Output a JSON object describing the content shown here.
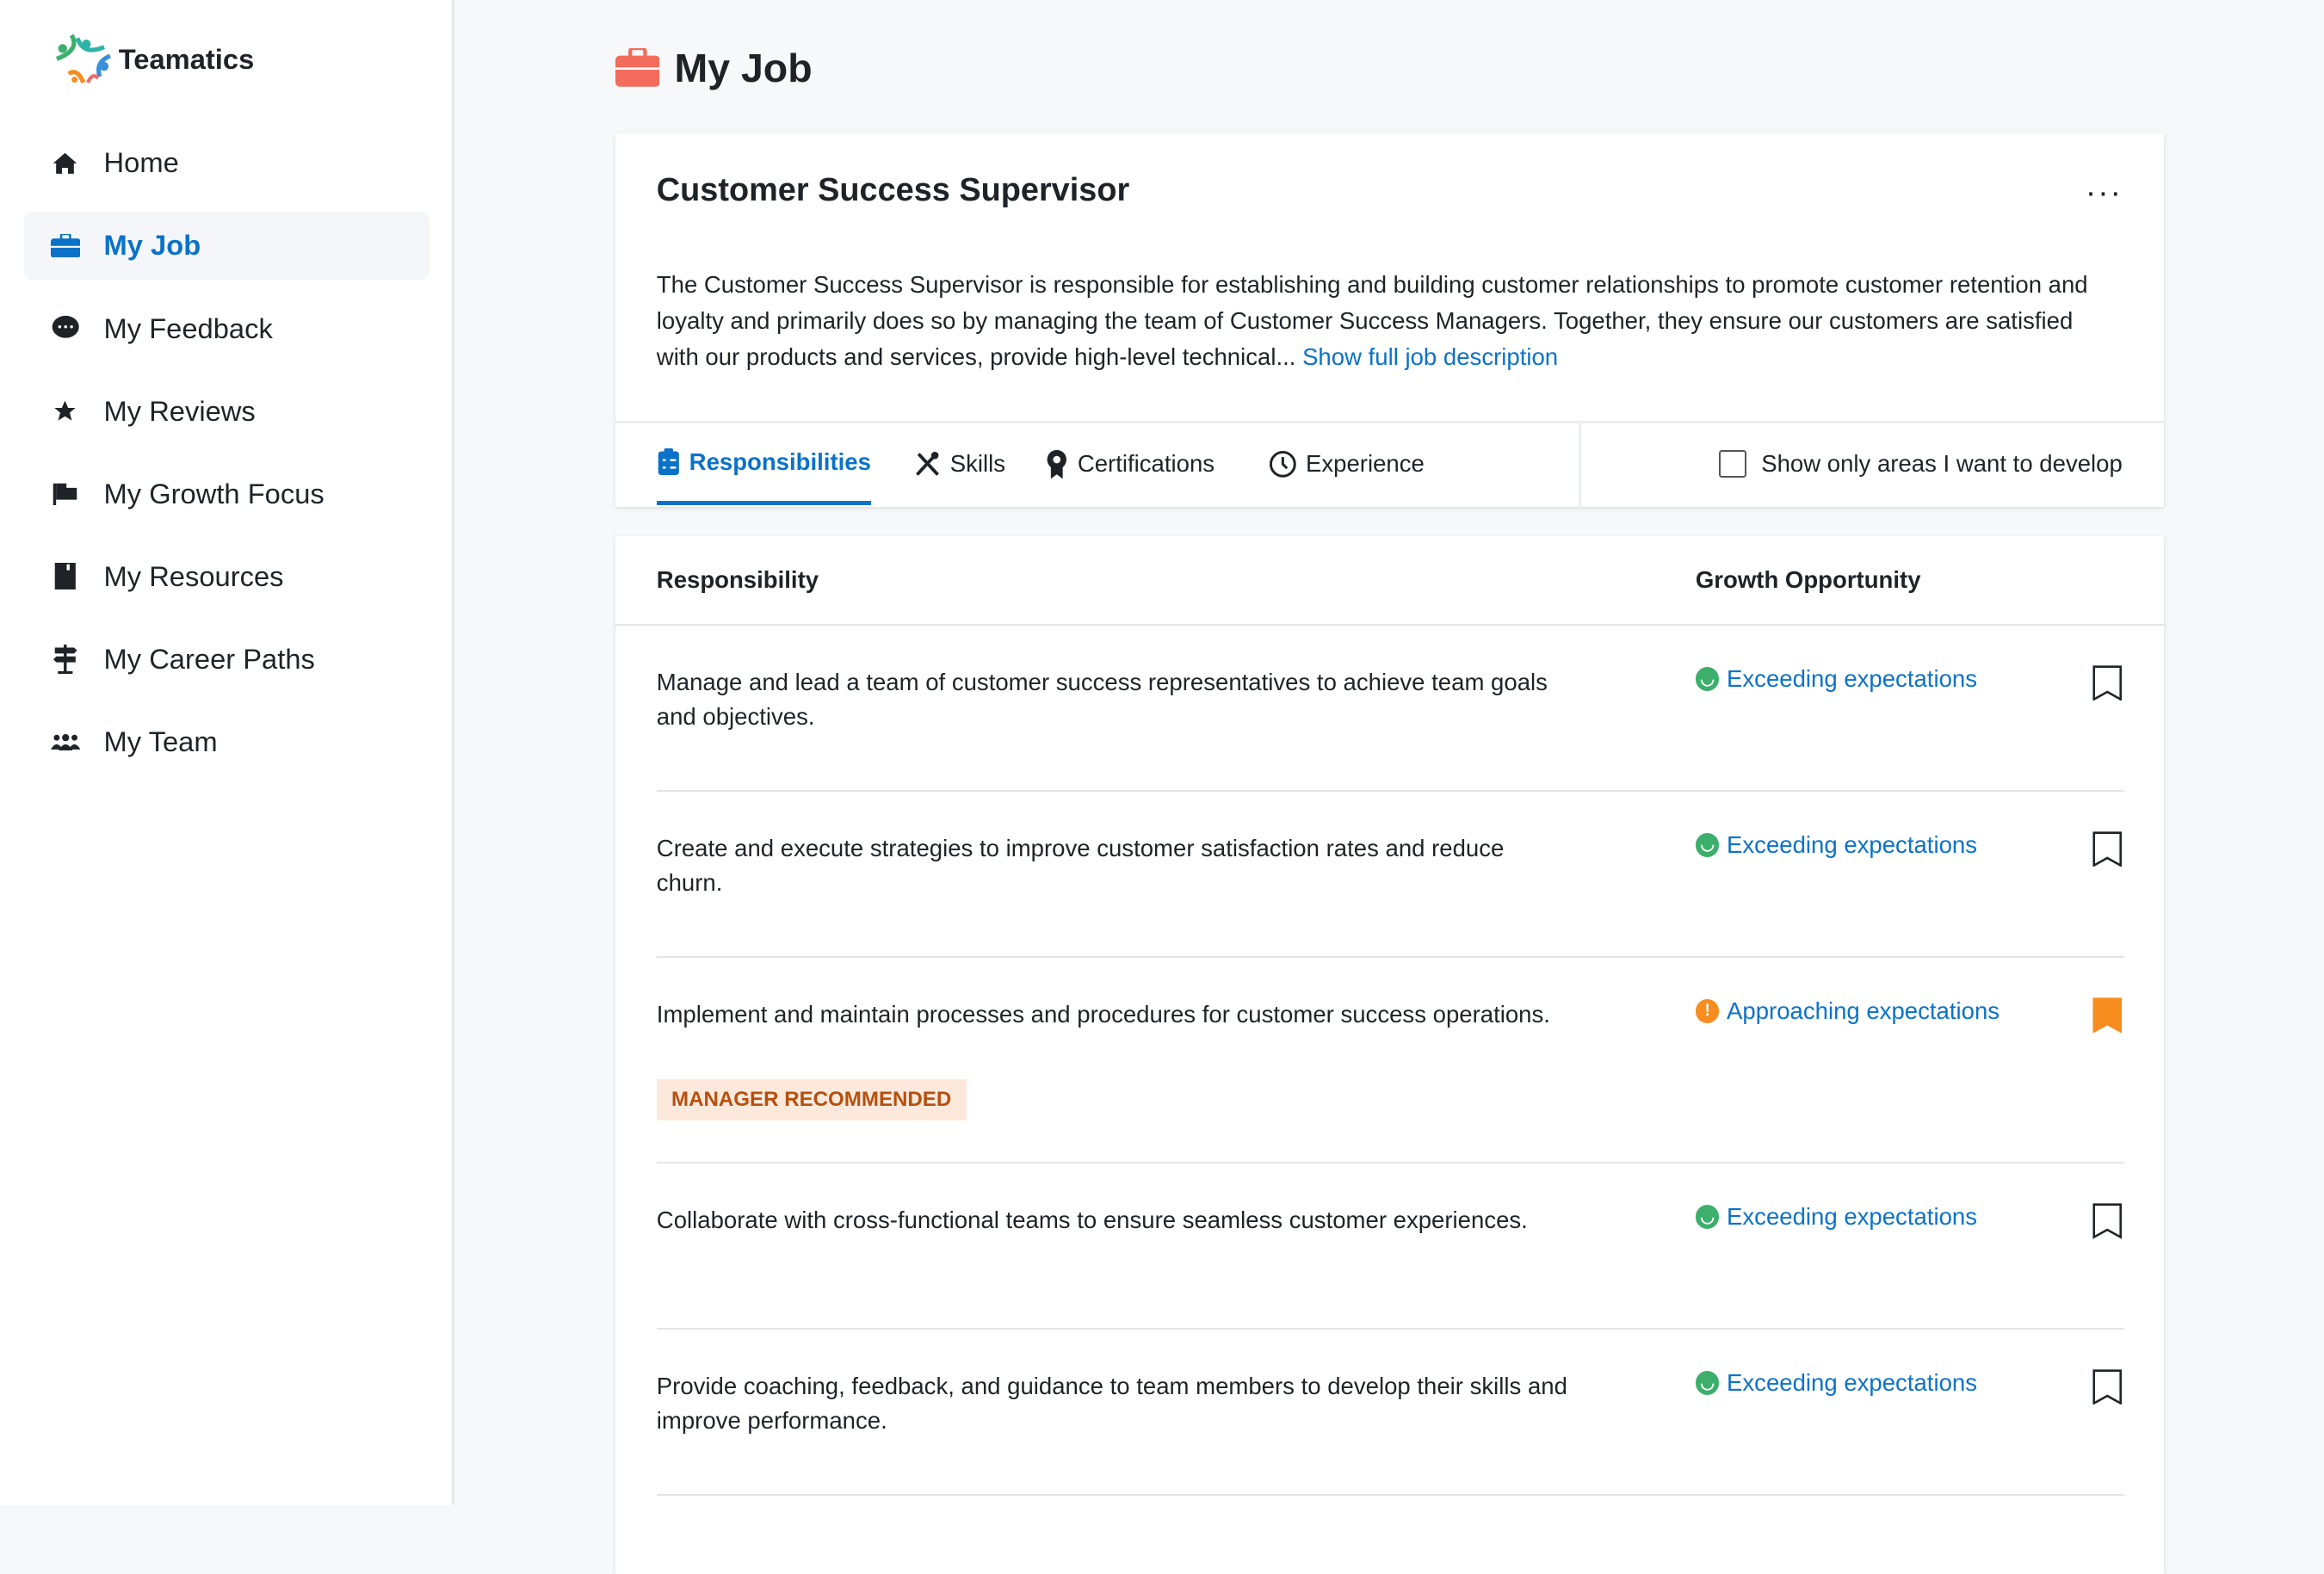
{
  "app": {
    "name": "Teamatics"
  },
  "sidebar": {
    "items": [
      {
        "label": "Home",
        "icon": "home-icon"
      },
      {
        "label": "My Job",
        "icon": "briefcase-icon",
        "active": true
      },
      {
        "label": "My Feedback",
        "icon": "chat-icon"
      },
      {
        "label": "My Reviews",
        "icon": "star-icon"
      },
      {
        "label": "My Growth Focus",
        "icon": "flag-icon"
      },
      {
        "label": "My Resources",
        "icon": "book-icon"
      },
      {
        "label": "My Career Paths",
        "icon": "signpost-icon"
      },
      {
        "label": "My Team",
        "icon": "team-icon"
      }
    ]
  },
  "page": {
    "title": "My Job"
  },
  "job": {
    "title": "Customer Success Supervisor",
    "description": "The Customer Success Supervisor is responsible for establishing and building customer relationships to promote customer retention and loyalty and primarily does so by managing the team of Customer Success Managers. Together, they ensure our customers are satisfied with our products and services, provide high-level technical...",
    "show_full": "Show full job description",
    "more": "···"
  },
  "tabs": [
    {
      "label": "Responsibilities"
    },
    {
      "label": "Skills"
    },
    {
      "label": "Certifications"
    },
    {
      "label": "Experience"
    }
  ],
  "filter": {
    "label": "Show only areas I want to develop",
    "checked": false
  },
  "table": {
    "headers": [
      "Responsibility",
      "Growth Opportunity"
    ],
    "rows": [
      {
        "text": "Manage and lead a team of customer success representatives to achieve team goals and objectives.",
        "status": "Exceeding expectations",
        "level": "exceeding",
        "bookmarked": false
      },
      {
        "text": "Create and execute strategies to improve customer satisfaction rates and reduce churn.",
        "status": "Exceeding expectations",
        "level": "exceeding",
        "bookmarked": false
      },
      {
        "text": "Implement and maintain processes and procedures for customer success operations.",
        "status": "Approaching expectations",
        "level": "approaching",
        "bookmarked": true,
        "badge": "MANAGER RECOMMENDED"
      },
      {
        "text": "Collaborate with cross-functional teams to ensure seamless customer experiences.",
        "status": "Exceeding expectations",
        "level": "exceeding",
        "bookmarked": false
      },
      {
        "text": "Provide coaching, feedback, and guidance to team members to develop their skills and improve performance.",
        "status": "Exceeding expectations",
        "level": "exceeding",
        "bookmarked": false
      }
    ]
  },
  "colors": {
    "accent": "#0a72c9",
    "exceeding": "#3daf6c",
    "approaching": "#f78c1f",
    "badge_bg": "#fde9dc",
    "badge_text": "#b5500e"
  }
}
